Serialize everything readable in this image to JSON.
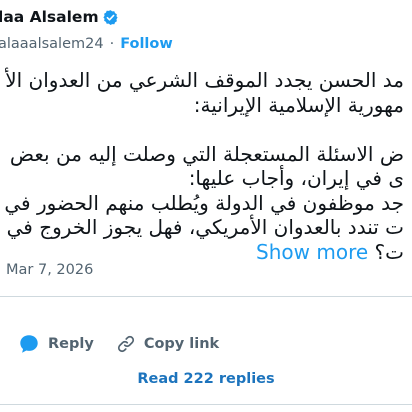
{
  "author": {
    "display_name": "laa Alsalem",
    "handle": "alaaalsalem24",
    "separator": "·",
    "follow_label": "Follow"
  },
  "tweet": {
    "lines": [
      "مد الحسن يجدد الموقف الشرعي من العدوان الأ",
      "مهورية الإسلامية الإيرانية:",
      "",
      "ض الاسئلة المستعجلة التي وصلت إليه من بعض",
      "ى في إيران، وأجاب عليها:",
      "جد موظفون في الدولة ويُطلب منهم الحضور في",
      "ت تندد بالعدوان الأمريكي، فهل يجوز الخروج في",
      "ت؟"
    ],
    "show_more_label": "Show more"
  },
  "timestamp": "Mar 7, 2026",
  "actions": {
    "reply_label": "Reply",
    "copy_link_label": "Copy link"
  },
  "read_replies_label": "Read 222 replies",
  "colors": {
    "accent": "#1d9bf0",
    "verified": "#1d9bf0",
    "muted": "#536471",
    "divider": "#cfd9de"
  },
  "icons": [
    "verified-badge-icon",
    "comment-icon",
    "link-icon"
  ]
}
